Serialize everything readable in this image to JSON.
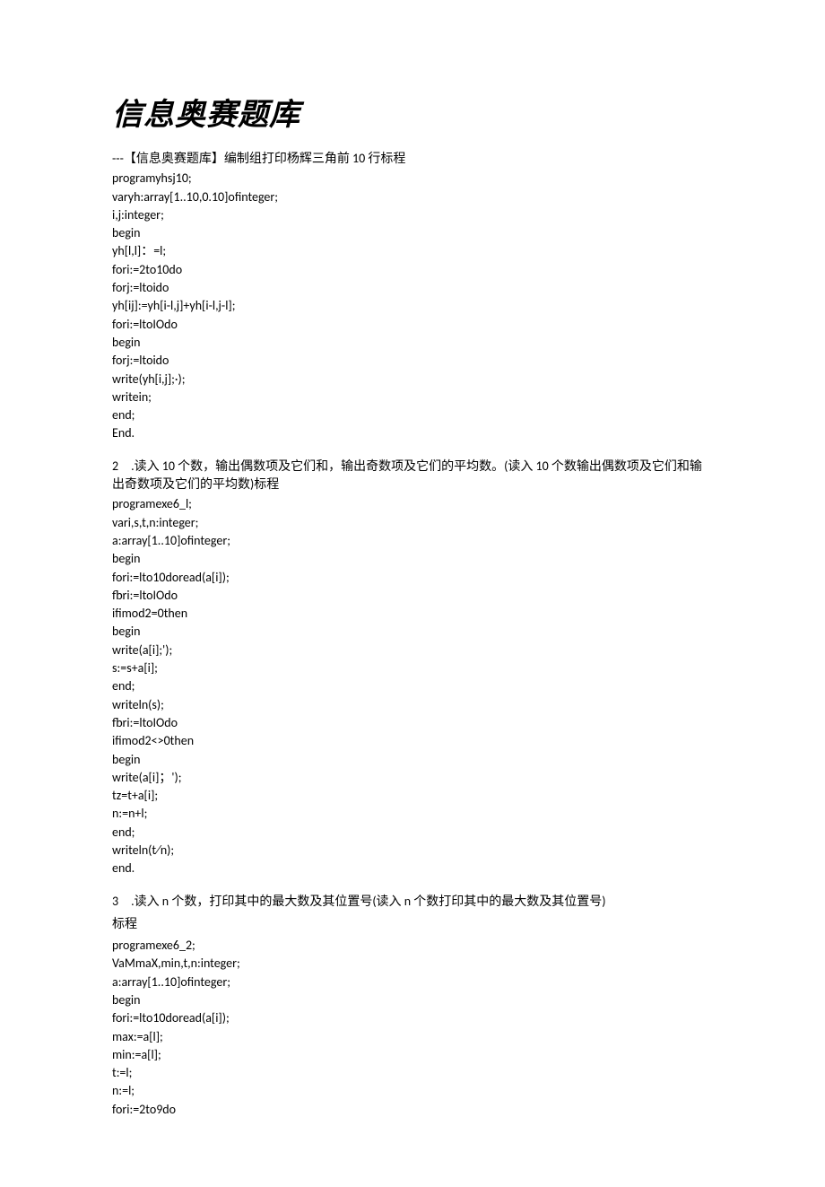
{
  "title": "信息奥赛题库",
  "problem1": {
    "heading": "---【信息奥赛题库】编制组打印杨辉三角前 10 行标程",
    "code": "programyhsj10;\nvaryh:array[1..10,0.10]ofinteger;\ni,j:integer;\nbegin\nyh[l,l]：=l;\nfori:=2to10do\nforj:=ltoido\nyh[ij]:=yh[i-l,j]+yh[i-l,j-l];\nfori:=ltoIOdo\nbegin\nforj:=ltoido\nwrite(yh[i,j];·);\nwritein;\nend;\nEnd."
  },
  "problem2": {
    "heading": "2 .读入 10 个数，输出偶数项及它们和，输出奇数项及它们的平均数。(读入 10 个数输出偶数项及它们和输出奇数项及它们的平均数)标程",
    "code": "programexe6_l;\nvari,s,t,n:integer;\na:array[1..10]ofinteger;\nbegin\nfori:=lto10doread(a[i]);\nfbri:=ltoIOdo\nifimod2=0then\nbegin\nwrite(a[i];');\ns:=s+a[i];\nend;\nwriteln(s);\nfbri:=ltoIOdo\nifimod2<>0then\nbegin\nwrite(a[i]；');\ntz=t+a[i];\nn:=n+l;\nend;\nwriteln(t⁄n);\nend."
  },
  "problem3": {
    "heading": "3 .读入 n 个数，打印其中的最大数及其位置号(读入 n 个数打印其中的最大数及其位置号)",
    "sub_label": "标程",
    "code": "programexe6_2;\nVaMmaX,min,t,n:integer;\na:array[1..10]ofinteger;\nbegin\nfori:=lto10doread(a[i]);\nmax:=a[l];\nmin:=a[l];\nt:=l;\nn:=l;\nfori:=2to9do"
  }
}
